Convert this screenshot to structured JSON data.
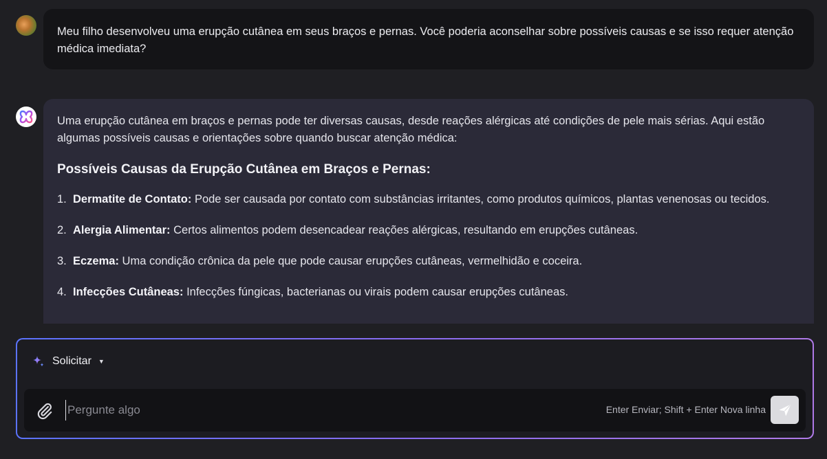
{
  "conversation": {
    "user_message": "Meu filho desenvolveu uma erupção cutânea em seus braços e pernas. Você poderia aconselhar sobre possíveis causas e se isso requer atenção médica imediata?",
    "assistant": {
      "intro": "Uma erupção cutânea em braços e pernas pode ter diversas causas, desde reações alérgicas até condições de pele mais sérias. Aqui estão algumas possíveis causas e orientações sobre quando buscar atenção médica:",
      "heading": "Possíveis Causas da Erupção Cutânea em Braços e Pernas:",
      "items": [
        {
          "num": "1.",
          "title": "Dermatite de Contato:",
          "text": " Pode ser causada por contato com substâncias irritantes, como produtos químicos, plantas venenosas ou tecidos."
        },
        {
          "num": "2.",
          "title": "Alergia Alimentar:",
          "text": " Certos alimentos podem desencadear reações alérgicas, resultando em erupções cutâneas."
        },
        {
          "num": "3.",
          "title": "Eczema:",
          "text": " Uma condição crônica da pele que pode causar erupções cutâneas, vermelhidão e coceira."
        },
        {
          "num": "4.",
          "title": "Infecções Cutâneas:",
          "text": " Infecções fúngicas, bacterianas ou virais podem causar erupções cutâneas."
        }
      ]
    }
  },
  "composer": {
    "mode_label": "Solicitar",
    "mode_icon": "sparkle-icon",
    "placeholder": "Pergunte algo",
    "value": "",
    "hint": "Enter Enviar; Shift + Enter Nova linha",
    "attach_icon": "paperclip-icon",
    "send_icon": "send-icon"
  },
  "colors": {
    "background": "#1f1f23",
    "user_bubble": "#141417",
    "assistant_bubble": "#2b2a38",
    "accent_start": "#5b73ff",
    "accent_end": "#b07ae8"
  }
}
